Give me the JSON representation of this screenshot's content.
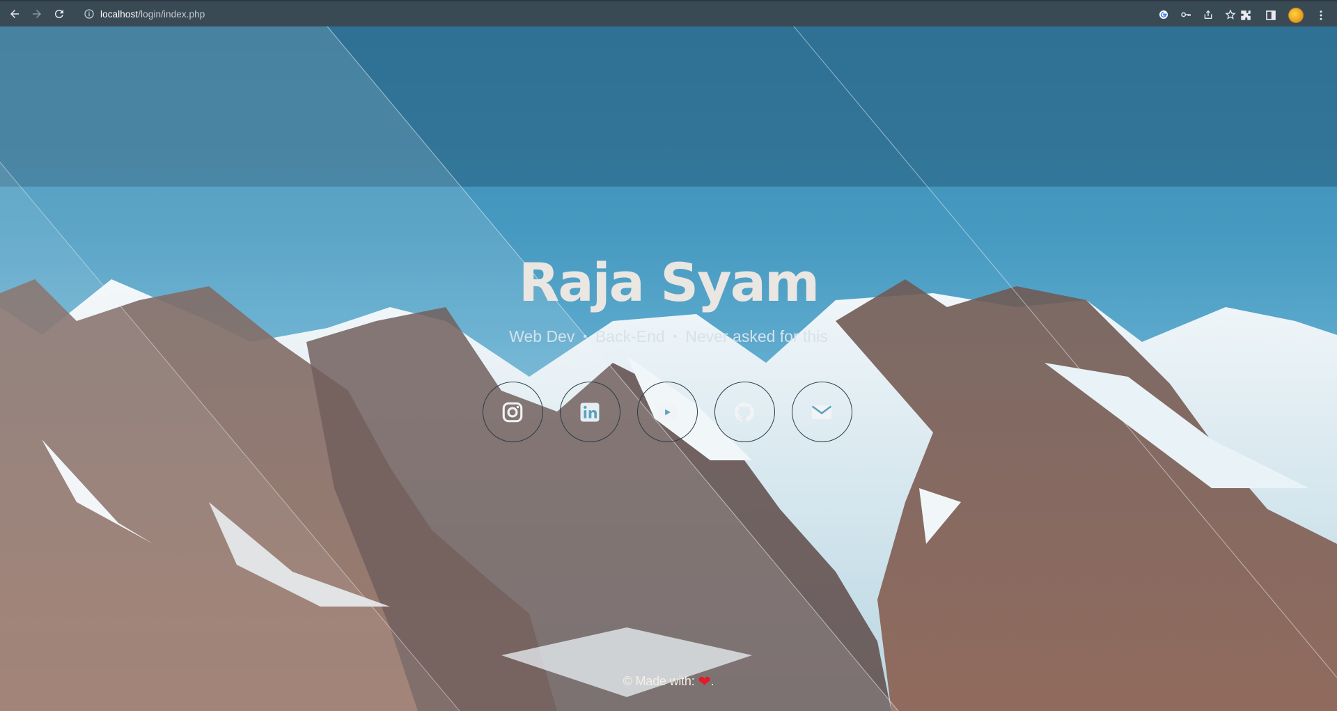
{
  "browser": {
    "url_host": "localhost",
    "url_path": "/login/index.php",
    "icons": [
      "back-icon",
      "forward-icon",
      "reload-icon",
      "info-icon",
      "google-icon",
      "key-icon",
      "share-icon",
      "star-icon",
      "extensions-icon",
      "sidepanel-icon",
      "menu-icon"
    ]
  },
  "hero": {
    "name": "Raja Syam",
    "tagline": [
      "Web Dev",
      "Back-End",
      "Never asked for this"
    ],
    "separator": "•"
  },
  "socials": [
    {
      "name": "instagram-icon"
    },
    {
      "name": "linkedin-icon"
    },
    {
      "name": "youtube-icon"
    },
    {
      "name": "github-icon"
    },
    {
      "name": "mail-icon"
    }
  ],
  "footer": {
    "text": "© Made with: ",
    "heart": "❤",
    "end": "."
  },
  "colors": {
    "sky": "#4699c0",
    "title": "#eae6e2",
    "heart": "#e21a2a"
  }
}
